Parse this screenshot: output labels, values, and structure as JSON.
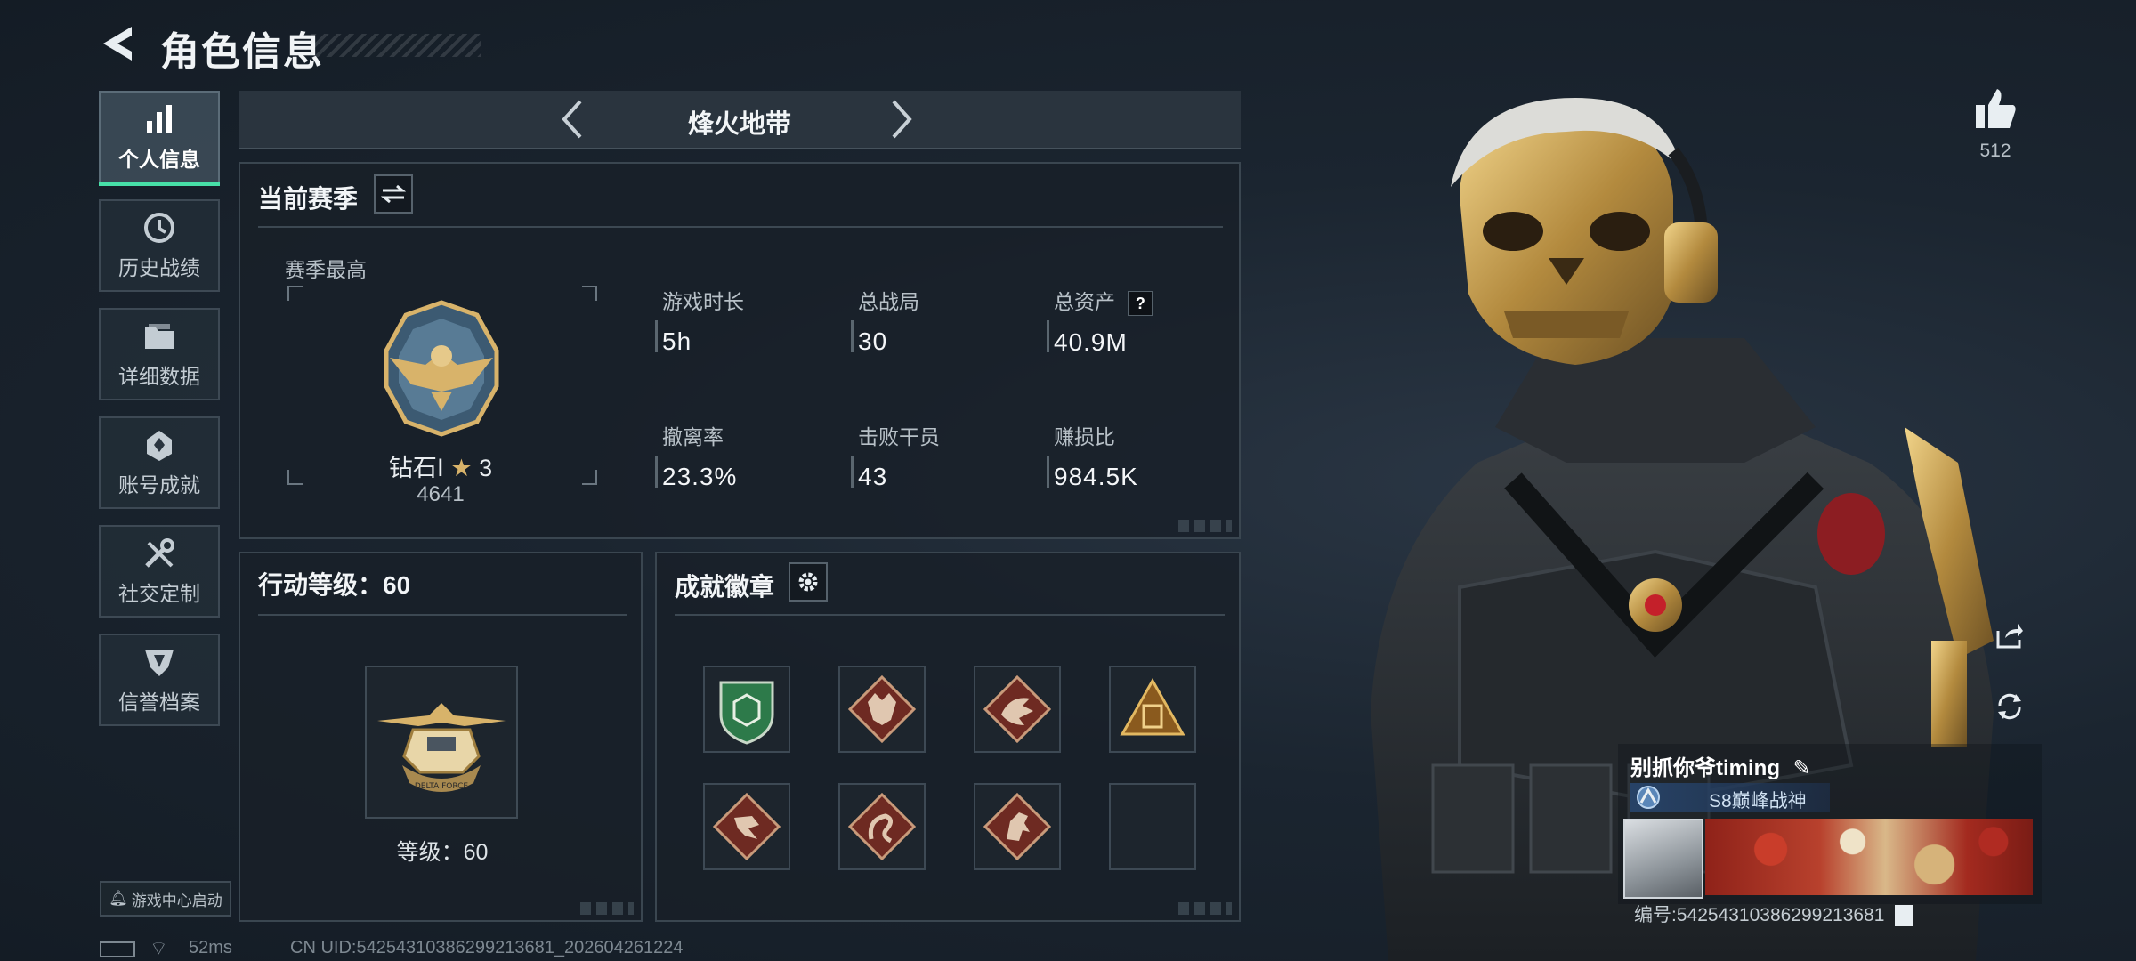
{
  "header": {
    "title": "角色信息"
  },
  "nav": {
    "items": [
      {
        "label": "个人信息",
        "icon": "bar-chart-icon",
        "active": true
      },
      {
        "label": "历史战绩",
        "icon": "history-clock-icon"
      },
      {
        "label": "详细数据",
        "icon": "folder-icon"
      },
      {
        "label": "账号成就",
        "icon": "achievement-icon"
      },
      {
        "label": "社交定制",
        "icon": "tools-icon"
      },
      {
        "label": "信誉档案",
        "icon": "shield-icon"
      }
    ],
    "launch_label": "游戏中心启动"
  },
  "mode": {
    "label": "烽火地带"
  },
  "season": {
    "title": "当前赛季",
    "best_label": "赛季最高",
    "rank": {
      "name": "钻石Ⅰ",
      "stars": "3",
      "score": "4641"
    },
    "stats": [
      {
        "label": "游戏时长",
        "value": "5h"
      },
      {
        "label": "总战局",
        "value": "30"
      },
      {
        "label": "总资产",
        "value": "40.9M",
        "help": "?"
      },
      {
        "label": "撤离率",
        "value": "23.3%"
      },
      {
        "label": "击败干员",
        "value": "43"
      },
      {
        "label": "赚损比",
        "value": "984.5K"
      }
    ]
  },
  "action_level": {
    "title": "行动等级：60",
    "level_text": "等级：60",
    "emblem_text": "DELTA FORCE"
  },
  "badges": {
    "title": "成就徽章",
    "items": [
      "green-shield-badge",
      "wolf-badge",
      "dragon-badge",
      "pyramid-badge",
      "runner-badge",
      "serpent-badge",
      "horse-badge",
      "empty-slot"
    ]
  },
  "social": {
    "likes": "512"
  },
  "player": {
    "name": "别抓你爷timing",
    "title": "S8巅峰战神",
    "id_text": "编号:54254310386299213681"
  },
  "status": {
    "ping": "52ms",
    "uid": "CN UID:54254310386299213681_202604261224"
  },
  "colors": {
    "accent": "#47e0a8",
    "gold": "#d8b36a",
    "panel_border": "#3a4650"
  }
}
